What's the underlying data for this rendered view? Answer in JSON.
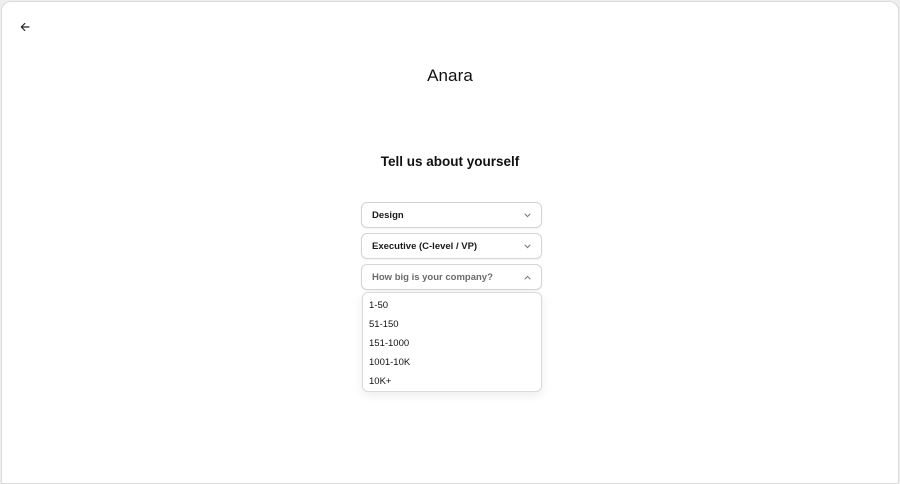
{
  "logo": "Anara",
  "heading": "Tell us about yourself",
  "selects": {
    "role": {
      "value": "Design"
    },
    "level": {
      "value": "Executive (C-level / VP)"
    },
    "company_size": {
      "placeholder": "How big is your company?"
    }
  },
  "dropdown": {
    "options": [
      "1-50",
      "51-150",
      "151-1000",
      "1001-10K",
      "10K+"
    ]
  },
  "icons": {
    "back": "arrow-left-icon",
    "chevron_down": "chevron-down-icon",
    "chevron_up": "chevron-up-icon"
  }
}
